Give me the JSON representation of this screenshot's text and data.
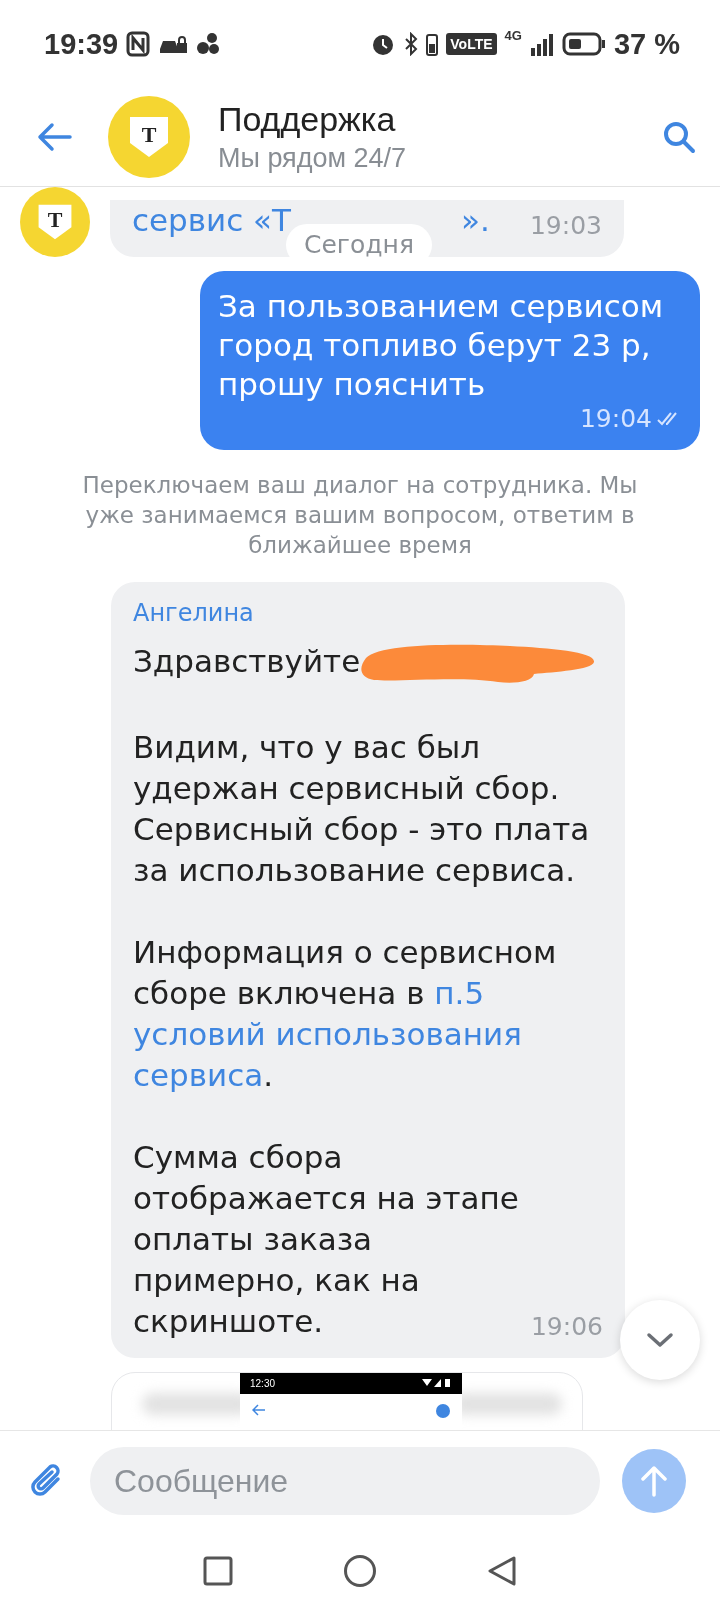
{
  "status_bar": {
    "time": "19:39",
    "network": "VoLTE",
    "network_type": "4G",
    "battery": "37 %"
  },
  "header": {
    "avatar_text": "Т",
    "title": "Поддержка",
    "subtitle": "Мы рядом 24/7"
  },
  "messages": [
    {
      "kind": "incoming_cut",
      "avatar_text": "Т",
      "before": "сервис «Т",
      "after": "».",
      "time": "19:03",
      "date_pill": "Сегодня"
    },
    {
      "kind": "outgoing",
      "text": "За пользованием сервисом город топливо берут 23 р, прошу пояснить",
      "time": "19:04",
      "read": true
    },
    {
      "kind": "system",
      "text": "Переключаем ваш диалог на сотрудника. Мы уже занимаемся вашим вопросом, ответим в ближайшее время"
    },
    {
      "kind": "incoming",
      "author": "Ангелина",
      "greeting": "Здравствуйте",
      "redacted": true,
      "time": "19:06",
      "paragraphs": [
        [
          {
            "text": "Видим, что у вас был удержан сервисный сбор. Сервисный сбор - это плата за использование сервиса.",
            "link": false
          }
        ],
        [
          {
            "text": "Информация о сервисном сборе включена в",
            "link": false
          },
          {
            "text": "п.5",
            "link": true
          },
          {
            "text": "условий использования",
            "link": true
          },
          {
            "text": "сервиса",
            "link": true
          },
          {
            "text": ".",
            "link": false
          }
        ],
        [
          {
            "text": "Сумма сбора отображается на этапе оплаты заказа примерно, как на скриншоте.",
            "link": false
          }
        ]
      ]
    },
    {
      "kind": "attachment",
      "preview_time": "12:30"
    }
  ],
  "composer": {
    "placeholder": "Сообщение"
  }
}
